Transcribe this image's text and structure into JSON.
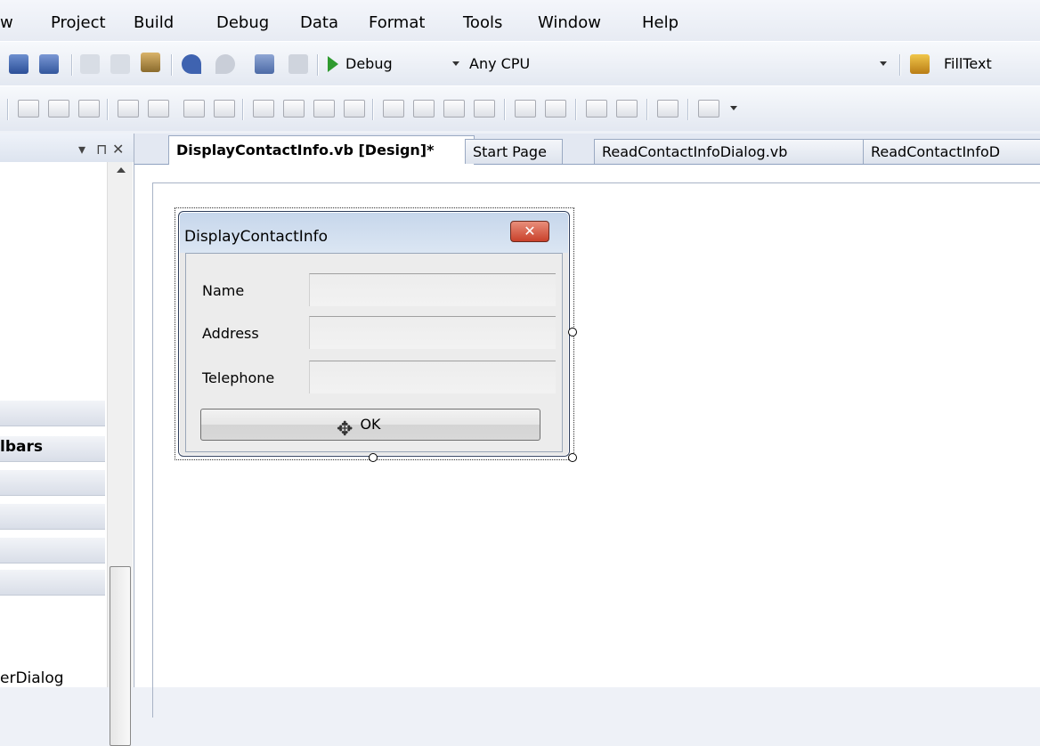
{
  "menu": [
    "w",
    "Project",
    "Build",
    "Debug",
    "Data",
    "Format",
    "Tools",
    "Window",
    "Help"
  ],
  "toolbar": {
    "config_combo": "Debug",
    "platform_combo": "Any CPU",
    "find_combo": "FillText",
    "icons": [
      "save-icon",
      "save-all-icon",
      "cut-icon",
      "copy-icon",
      "paste-icon",
      "undo-icon",
      "redo-icon",
      "navigate-icon",
      "solution-icon",
      "start-debug-icon",
      "find-in-files-icon"
    ]
  },
  "leftpanel": {
    "pin_glyph": "▾ ⊓ ✕",
    "bars_label": "lbars",
    "bottom_text": "erDialog"
  },
  "tabs": [
    {
      "label": "DisplayContactInfo.vb [Design]*",
      "active": true
    },
    {
      "label": "Start Page",
      "active": false
    },
    {
      "label": "ReadContactInfoDialog.vb",
      "active": false
    },
    {
      "label": "ReadContactInfoD",
      "active": false
    }
  ],
  "form": {
    "title": "DisplayContactInfo",
    "close_glyph": "✕",
    "fields": [
      {
        "label": "Name"
      },
      {
        "label": "Address"
      },
      {
        "label": "Telephone"
      }
    ],
    "ok_label": "OK"
  }
}
